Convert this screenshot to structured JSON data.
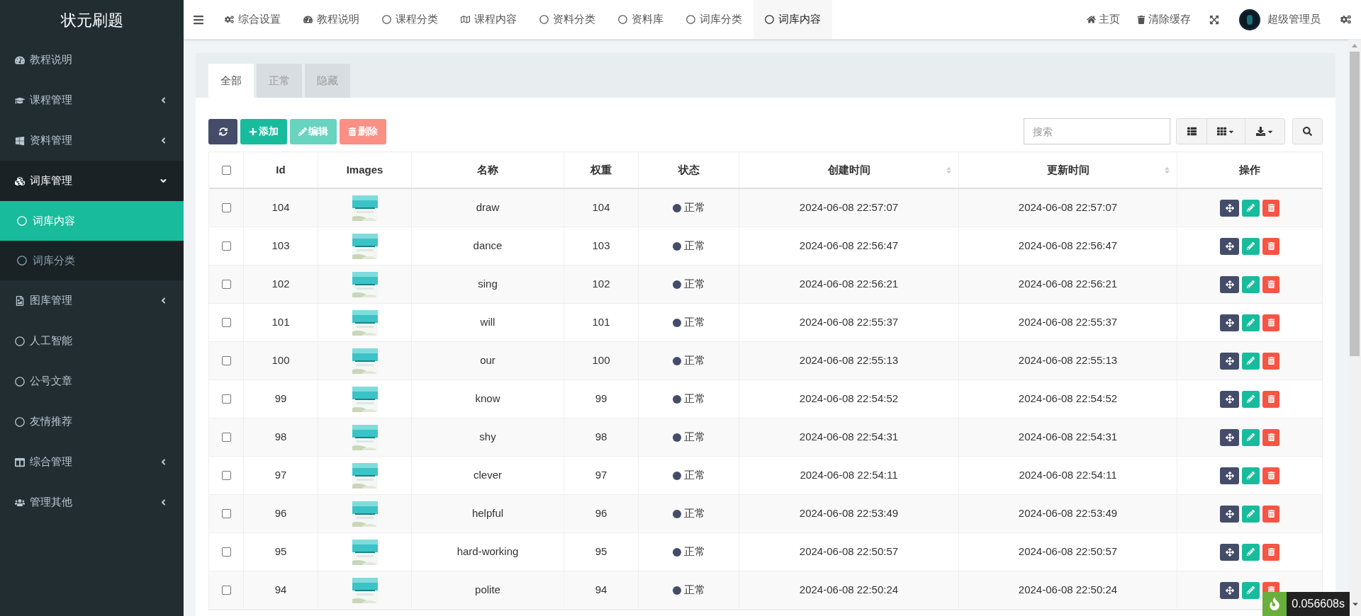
{
  "sidebar": {
    "logo": "状元刷题",
    "items": [
      {
        "label": "教程说明"
      },
      {
        "label": "课程管理",
        "expanded": false
      },
      {
        "label": "资料管理",
        "expanded": false
      },
      {
        "label": "词库管理",
        "expanded": true,
        "children": [
          {
            "label": "词库内容",
            "selected": true
          },
          {
            "label": "词库分类",
            "selected": false
          }
        ]
      },
      {
        "label": "图库管理",
        "expanded": false
      },
      {
        "label": "人工智能"
      },
      {
        "label": "公号文章"
      },
      {
        "label": "友情推荐"
      },
      {
        "label": "综合管理",
        "expanded": false
      },
      {
        "label": "管理其他",
        "expanded": false
      }
    ]
  },
  "top_tabs": [
    {
      "label": "综合设置",
      "selected": false
    },
    {
      "label": "教程说明",
      "selected": false
    },
    {
      "label": "课程分类",
      "selected": false
    },
    {
      "label": "课程内容",
      "selected": false
    },
    {
      "label": "资料分类",
      "selected": false
    },
    {
      "label": "资料库",
      "selected": false
    },
    {
      "label": "词库分类",
      "selected": false
    },
    {
      "label": "词库内容",
      "selected": true
    }
  ],
  "top_right": {
    "home": "主页",
    "clear_cache": "清除缓存",
    "user": "超级管理员"
  },
  "content_tabs": [
    {
      "label": "全部",
      "selected": true
    },
    {
      "label": "正常",
      "selected": false
    },
    {
      "label": "隐藏",
      "selected": false
    }
  ],
  "toolbar": {
    "buttons": [
      {
        "kind": "refresh",
        "disabled": false
      },
      {
        "kind": "add",
        "label": "添加",
        "disabled": false
      },
      {
        "kind": "edit",
        "label": "编辑",
        "disabled": true
      },
      {
        "kind": "delete",
        "label": "删除",
        "disabled": true
      }
    ],
    "search": {
      "placeholder": "搜索"
    }
  },
  "table": {
    "header_checked": false,
    "columns": [
      {
        "label": "Id",
        "sortable": false
      },
      {
        "label": "Images",
        "sortable": false
      },
      {
        "label": "名称",
        "sortable": false
      },
      {
        "label": "权重",
        "sortable": false
      },
      {
        "label": "状态",
        "sortable": false
      },
      {
        "label": "创建时间",
        "sortable": true
      },
      {
        "label": "更新时间",
        "sortable": true
      },
      {
        "label": "操作",
        "sortable": false
      }
    ],
    "rows": [
      {
        "checked": false,
        "id": "104",
        "name": "draw",
        "weight": "104",
        "status": "正常",
        "created": "2024-06-08 22:57:07",
        "updated": "2024-06-08 22:57:07"
      },
      {
        "checked": false,
        "id": "103",
        "name": "dance",
        "weight": "103",
        "status": "正常",
        "created": "2024-06-08 22:56:47",
        "updated": "2024-06-08 22:56:47"
      },
      {
        "checked": false,
        "id": "102",
        "name": "sing",
        "weight": "102",
        "status": "正常",
        "created": "2024-06-08 22:56:21",
        "updated": "2024-06-08 22:56:21"
      },
      {
        "checked": false,
        "id": "101",
        "name": "will",
        "weight": "101",
        "status": "正常",
        "created": "2024-06-08 22:55:37",
        "updated": "2024-06-08 22:55:37"
      },
      {
        "checked": false,
        "id": "100",
        "name": "our",
        "weight": "100",
        "status": "正常",
        "created": "2024-06-08 22:55:13",
        "updated": "2024-06-08 22:55:13"
      },
      {
        "checked": false,
        "id": "99",
        "name": "know",
        "weight": "99",
        "status": "正常",
        "created": "2024-06-08 22:54:52",
        "updated": "2024-06-08 22:54:52"
      },
      {
        "checked": false,
        "id": "98",
        "name": "shy",
        "weight": "98",
        "status": "正常",
        "created": "2024-06-08 22:54:31",
        "updated": "2024-06-08 22:54:31"
      },
      {
        "checked": false,
        "id": "97",
        "name": "clever",
        "weight": "97",
        "status": "正常",
        "created": "2024-06-08 22:54:11",
        "updated": "2024-06-08 22:54:11"
      },
      {
        "checked": false,
        "id": "96",
        "name": "helpful",
        "weight": "96",
        "status": "正常",
        "created": "2024-06-08 22:53:49",
        "updated": "2024-06-08 22:53:49"
      },
      {
        "checked": false,
        "id": "95",
        "name": "hard-working",
        "weight": "95",
        "status": "正常",
        "created": "2024-06-08 22:50:57",
        "updated": "2024-06-08 22:50:57"
      },
      {
        "checked": false,
        "id": "94",
        "name": "polite",
        "weight": "94",
        "status": "正常",
        "created": "2024-06-08 22:50:24",
        "updated": "2024-06-08 22:50:24"
      }
    ]
  },
  "debug_timer": "0.056608s"
}
